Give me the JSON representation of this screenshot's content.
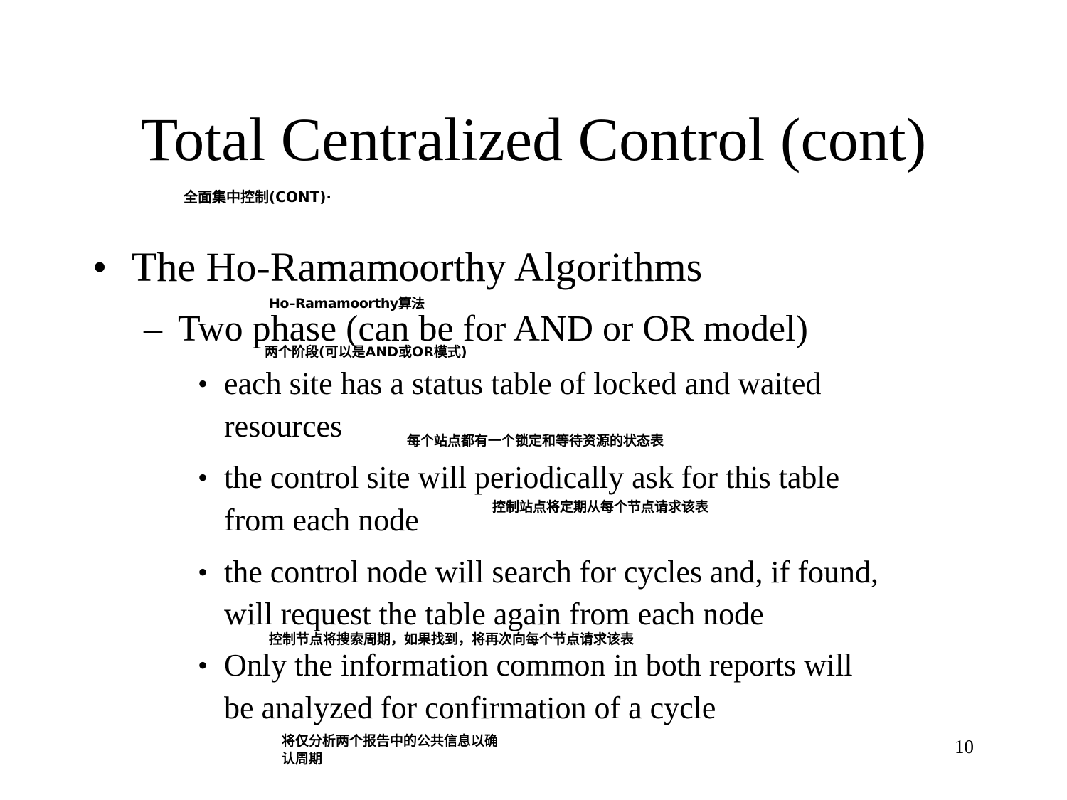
{
  "slide": {
    "title": "Total Centralized Control (cont)",
    "title_translation": "全面集中控制(CONT)·",
    "bullet_char": "•",
    "dash_char": "–",
    "level1": {
      "text": "The Ho-Ramamoorthy Algorithms",
      "translation": "Ho–Ramamoorthy算法"
    },
    "level2": {
      "text": "Two phase (can be for AND or OR model)",
      "translation": "两个阶段(可以是AND或OR模式)"
    },
    "level3": [
      {
        "line1": "each site has a status table of locked and waited",
        "line2": "resources",
        "translation": "每个站点都有一个锁定和等待资源的状态表"
      },
      {
        "line1": "the control site will periodically ask for this table",
        "line2": "from each node",
        "translation": "控制站点将定期从每个节点请求该表"
      },
      {
        "line1": "the control node will search for cycles and, if found,",
        "line2": "will request the table again from each node",
        "translation": "控制节点将搜索周期，如果找到，将再次向每个节点请求该表"
      },
      {
        "line1": "Only the information common in both reports will",
        "line2": "be analyzed for confirmation of a cycle",
        "translation_line1": "将仅分析两个报告中的公共信息以确",
        "translation_line2": "认周期"
      }
    ],
    "page_number": "10"
  }
}
